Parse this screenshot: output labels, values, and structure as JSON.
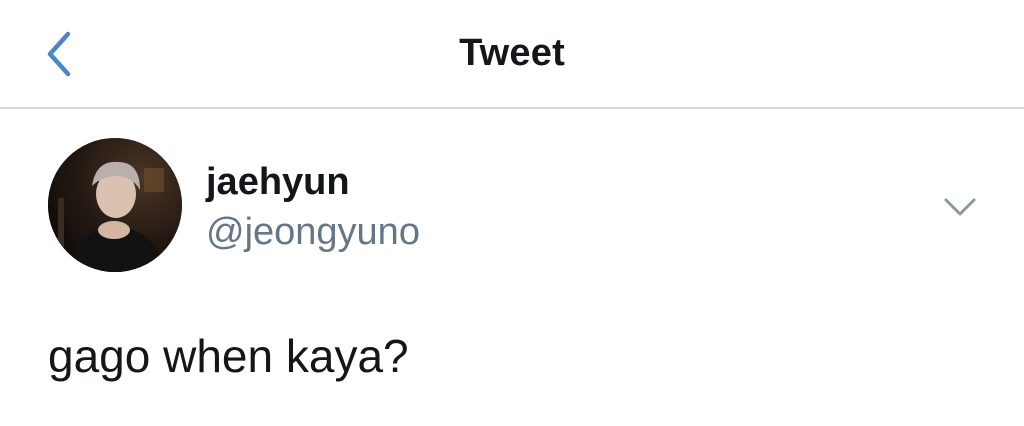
{
  "header": {
    "back_icon": "chevron-left-icon",
    "title": "Tweet",
    "accent_color": "#4a86c6"
  },
  "tweet": {
    "author": {
      "display_name": "jaehyun",
      "handle": "@jeongyuno",
      "avatar": "profile-photo"
    },
    "menu_icon": "chevron-down-icon",
    "text": "gago when kaya?"
  }
}
